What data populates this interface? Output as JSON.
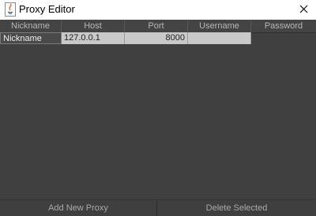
{
  "window": {
    "title": "Proxy Editor",
    "app_icon": "java-icon",
    "close_icon": "close-icon"
  },
  "table": {
    "columns": [
      "Nickname",
      "Host",
      "Port",
      "Username",
      "Password"
    ],
    "rows": [
      {
        "nickname": "Nickname",
        "host": "127.0.0.1",
        "port": "8000",
        "username": "",
        "password": ""
      }
    ]
  },
  "buttons": {
    "add_label": "Add New Proxy",
    "delete_label": "Delete Selected"
  },
  "colors": {
    "background": "#404040",
    "header_text": "#b7b7b7",
    "selected_cell": "#c9c9c9"
  }
}
